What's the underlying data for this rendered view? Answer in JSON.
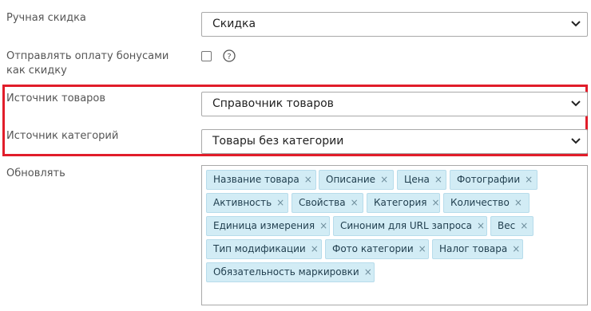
{
  "form": {
    "manual_discount": {
      "label": "Ручная скидка",
      "value": "Скидка"
    },
    "bonus_as_discount": {
      "label": "Отправлять оплату бонусами как скидку",
      "help": "?"
    },
    "product_source": {
      "label": "Источник товаров",
      "value": "Справочник товаров"
    },
    "category_source": {
      "label": "Источник категорий",
      "value": "Товары без категории"
    },
    "update": {
      "label": "Обновлять",
      "remove_symbol": "×",
      "tags": [
        "Название товара",
        "Описание",
        "Цена",
        "Фотографии",
        "Активность",
        "Свойства",
        "Категория",
        "Количество",
        "Единица измерения",
        "Синоним для URL запроса",
        "Вес",
        "Тип модификации",
        "Фото категории",
        "Налог товара",
        "Обязательность маркировки"
      ]
    }
  },
  "colors": {
    "highlight": "#e11d2a",
    "tag_bg": "#d2ecf5",
    "tag_border": "#b7dceb"
  },
  "icons": {
    "dropdown": "chevron-down-icon",
    "help": "question-circle-icon",
    "remove": "close-icon"
  }
}
